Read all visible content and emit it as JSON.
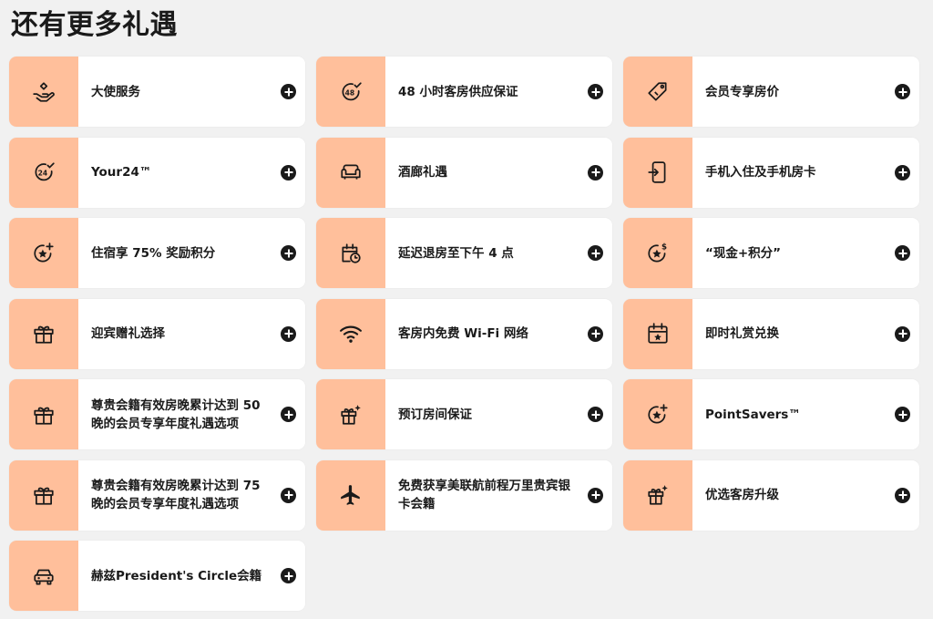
{
  "page": {
    "title": "还有更多礼遇"
  },
  "colors": {
    "accent": "#ffbf9b",
    "card_bg": "#ffffff",
    "page_bg": "#f1f1f1",
    "text": "#1a1a1a"
  },
  "benefits": [
    {
      "label": "大使服务",
      "icon": "hand-heart-icon"
    },
    {
      "label": "48 小时客房供应保证",
      "icon": "clock-48-icon"
    },
    {
      "label": "会员专享房价",
      "icon": "price-tag-icon"
    },
    {
      "label": "Your24™",
      "icon": "clock-24-icon"
    },
    {
      "label": "酒廊礼遇",
      "icon": "sofa-icon"
    },
    {
      "label": "手机入住及手机房卡",
      "icon": "mobile-key-icon"
    },
    {
      "label": "住宿享 75% 奖励积分",
      "icon": "star-plus-icon"
    },
    {
      "label": "延迟退房至下午 4 点",
      "icon": "calendar-clock-icon"
    },
    {
      "label": "“现金+积分”",
      "icon": "star-dollar-icon"
    },
    {
      "label": "迎宾赠礼选择",
      "icon": "gift-icon"
    },
    {
      "label": "客房内免费 Wi-Fi 网络",
      "icon": "wifi-icon"
    },
    {
      "label": "即时礼赏兑换",
      "icon": "calendar-star-icon"
    },
    {
      "label": "尊贵会籍有效房晚累计达到 50 晚的会员专享年度礼遇选项",
      "icon": "gift-icon"
    },
    {
      "label": "预订房间保证",
      "icon": "gift-sparkle-icon"
    },
    {
      "label": "PointSavers™",
      "icon": "star-plus-icon"
    },
    {
      "label": "尊贵会籍有效房晚累计达到 75 晚的会员专享年度礼遇选项",
      "icon": "gift-icon"
    },
    {
      "label": "免费获享美联航前程万里贵宾银卡会籍",
      "icon": "airplane-icon"
    },
    {
      "label": "优选客房升级",
      "icon": "gift-sparkle-icon"
    },
    {
      "label": "赫兹President's Circle会籍",
      "icon": "car-icon"
    }
  ]
}
